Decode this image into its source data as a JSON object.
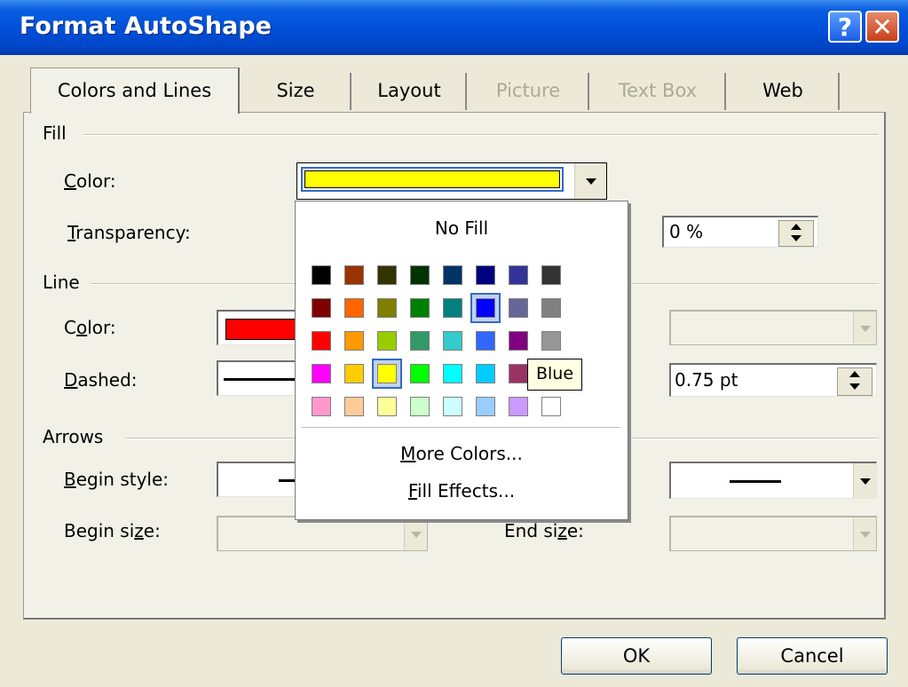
{
  "window": {
    "title": "Format AutoShape"
  },
  "titlebar": {
    "help_label": "?",
    "close_label": "✕"
  },
  "tabs": [
    {
      "label": "Colors and Lines",
      "state": "active"
    },
    {
      "label": "Size",
      "state": "normal"
    },
    {
      "label": "Layout",
      "state": "normal"
    },
    {
      "label": "Picture",
      "state": "disabled"
    },
    {
      "label": "Text Box",
      "state": "disabled"
    },
    {
      "label": "Web",
      "state": "normal"
    }
  ],
  "fill": {
    "group_label": "Fill",
    "color_label": "Color:",
    "color_value": "#ffff00",
    "transparency_label": "Transparency:",
    "transparency_value": "0 %"
  },
  "line": {
    "group_label": "Line",
    "color_label": "Color:",
    "color_value": "#ff0000",
    "dashed_label": "Dashed:",
    "weight_value": "0.75 pt"
  },
  "arrows": {
    "group_label": "Arrows",
    "begin_style_label": "Begin style:",
    "begin_size_label": "Begin size:",
    "end_size_label": "End size:"
  },
  "popup": {
    "no_fill_label": "No Fill",
    "more_colors_label": "More Colors...",
    "fill_effects_label": "Fill Effects...",
    "tooltip_label": "Blue",
    "selected_color": "Yellow",
    "hovered_color": "Blue",
    "palette": [
      [
        "#000000",
        "#993300",
        "#333300",
        "#003300",
        "#003366",
        "#000080",
        "#333399",
        "#333333"
      ],
      [
        "#800000",
        "#ff6600",
        "#808000",
        "#008000",
        "#008080",
        "#0000ff",
        "#666699",
        "#808080"
      ],
      [
        "#ff0000",
        "#ff9900",
        "#99cc00",
        "#339966",
        "#33cccc",
        "#3366ff",
        "#800080",
        "#969696"
      ],
      [
        "#ff00ff",
        "#ffcc00",
        "#ffff00",
        "#00ff00",
        "#00ffff",
        "#00ccff",
        "#993366",
        "#c0c0c0"
      ],
      [
        "#ff99cc",
        "#ffcc99",
        "#ffff99",
        "#ccffcc",
        "#ccffff",
        "#99ccff",
        "#cc99ff",
        "#ffffff"
      ]
    ]
  },
  "buttons": {
    "ok_label": "OK",
    "cancel_label": "Cancel"
  }
}
